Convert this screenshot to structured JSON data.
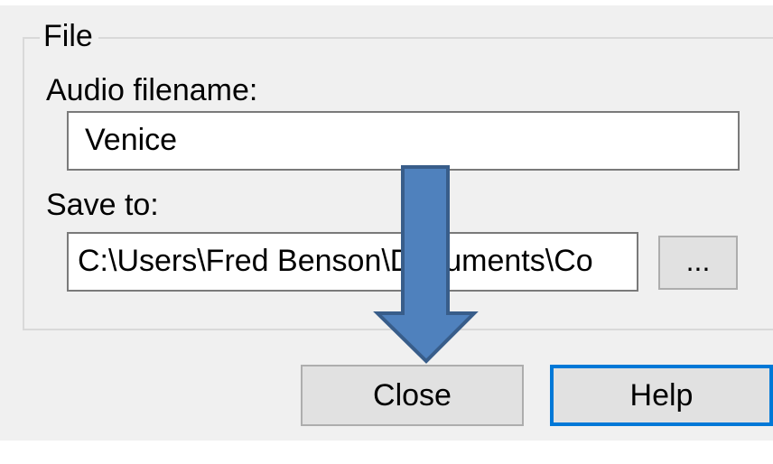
{
  "group": {
    "legend": "File"
  },
  "audio": {
    "label": "Audio filename:",
    "value": "Venice"
  },
  "save": {
    "label": "Save to:",
    "value": "C:\\Users\\Fred Benson\\Documents\\Co",
    "browse_label": "..."
  },
  "buttons": {
    "close_label": "Close",
    "help_label": "Help"
  },
  "annotation": {
    "icon": "down-arrow-icon",
    "fill_color": "#4f81bd",
    "stroke_color": "#385d8a"
  },
  "colors": {
    "focus_border": "#0078d7",
    "dialog_bg": "#f0f0f0"
  }
}
